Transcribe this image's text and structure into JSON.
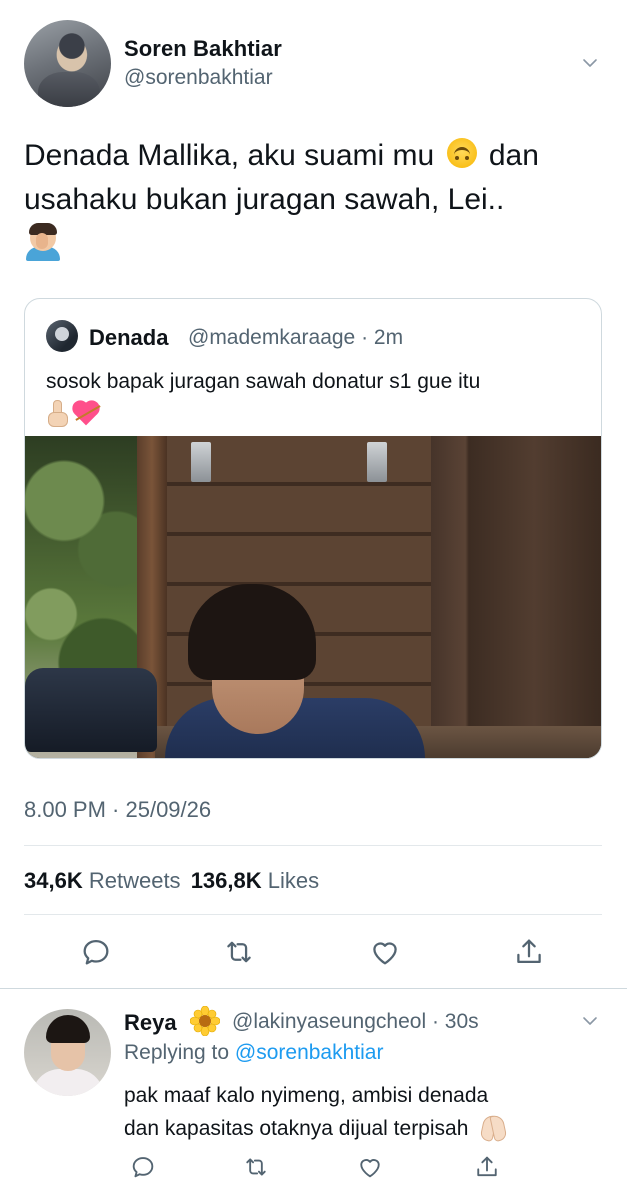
{
  "tweet": {
    "author_name": "Soren Bakhtiar",
    "author_handle": "@sorenbakhtiar",
    "text_line1_a": "Denada Mallika, aku suami mu",
    "text_line1_b": "dan",
    "text_line2": "usahaku bukan juragan sawah, Lei..",
    "timestamp": "8.00 PM · 25/09/26",
    "retweets_count": "34,6K",
    "retweets_label": "Retweets",
    "likes_count": "136,8K",
    "likes_label": "Likes"
  },
  "quoted_tweet": {
    "author_name": "Denada",
    "author_handle": "@mademkaraage",
    "time": "· 2m",
    "text": "sosok bapak juragan sawah donatur s1 gue itu"
  },
  "reply": {
    "author_name": "Reya",
    "author_handle": "@lakinyaseungcheol",
    "time": "· 30s",
    "replying_to_label": "Replying to",
    "replying_to_handle": "@sorenbakhtiar",
    "text_line1": "pak maaf kalo nyimeng, ambisi denada",
    "text_line2": "dan kapasitas otaknya dijual terpisah"
  },
  "icons": {
    "reply": "reply-icon",
    "retweet": "retweet-icon",
    "like": "heart-icon",
    "share": "share-icon",
    "caret": "chevron-down-icon"
  },
  "colors": {
    "accent": "#1d9bf0",
    "secondary_text": "#536471",
    "primary_text": "#0f1419",
    "divider": "#cfd9de"
  }
}
